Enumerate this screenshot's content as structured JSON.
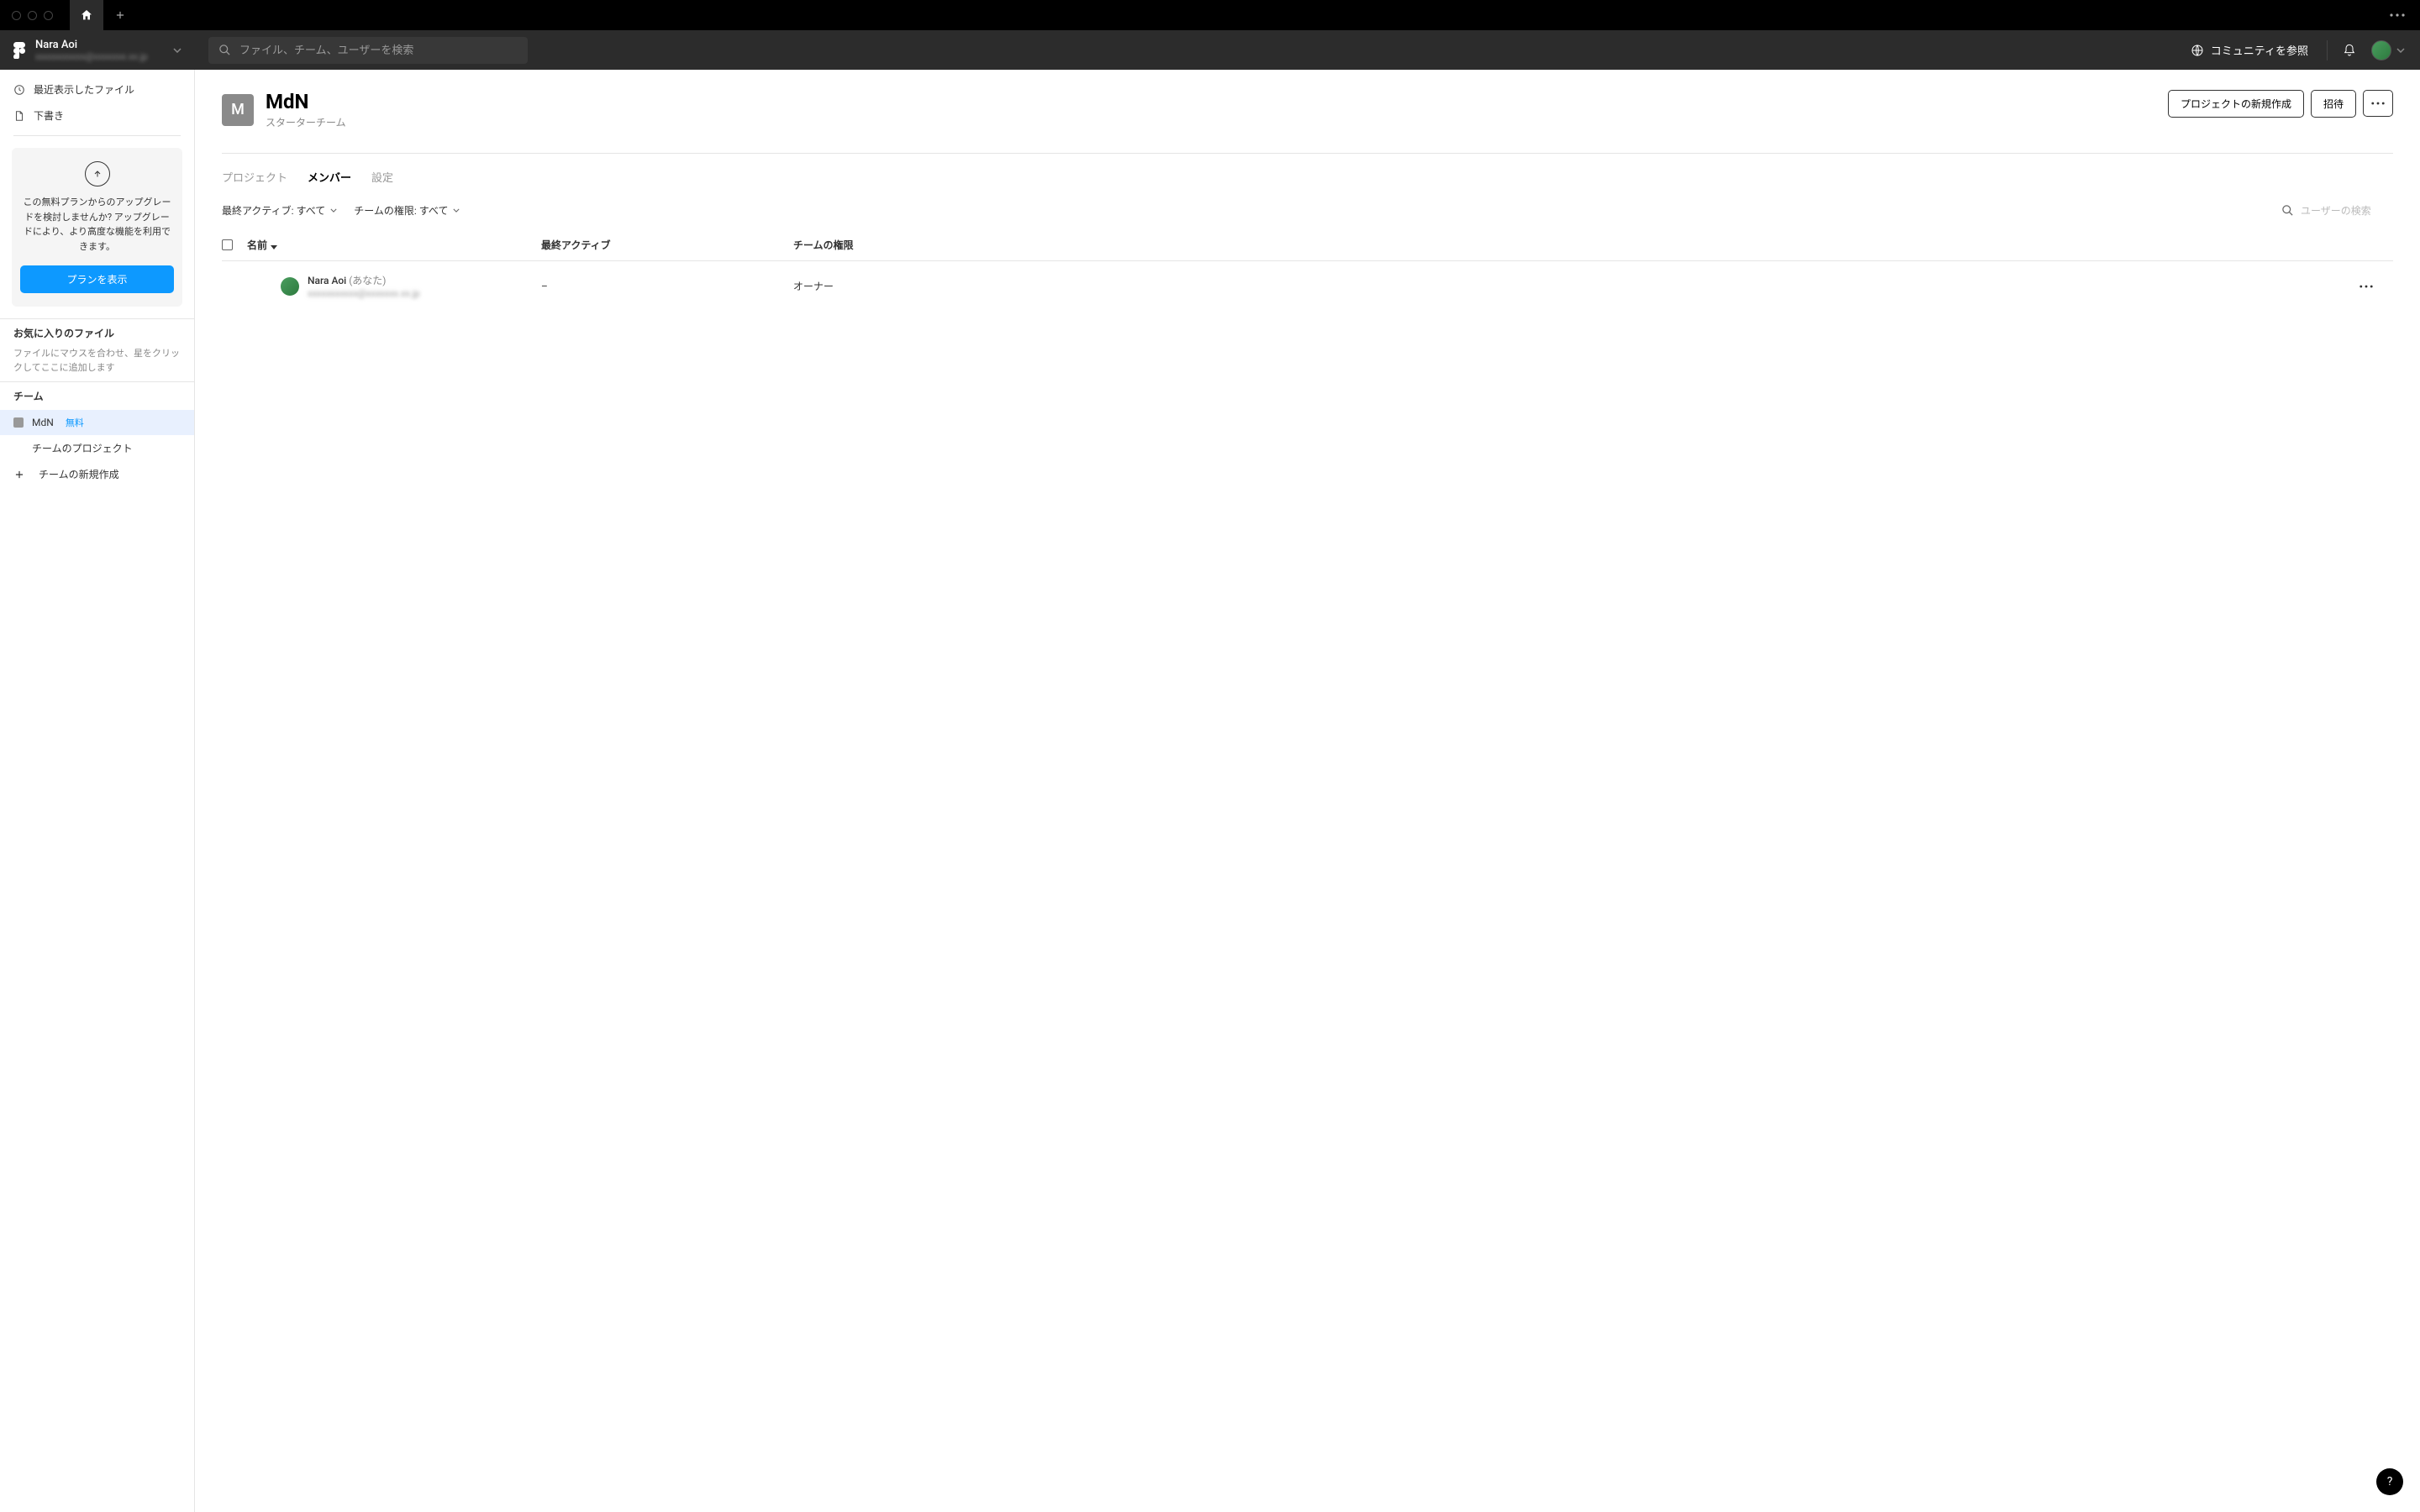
{
  "user": {
    "name": "Nara Aoi",
    "email": "xxxxxxxxxxx@xxxxxxx.xx.jp"
  },
  "search": {
    "placeholder": "ファイル、チーム、ユーザーを検索"
  },
  "topbar": {
    "community": "コミュニティを参照"
  },
  "sidebar": {
    "recent": "最近表示したファイル",
    "drafts": "下書き",
    "upgrade_text": "この無料プランからのアップグレードを検討しませんか? アップグレードにより、より高度な機能を利用できます。",
    "upgrade_btn": "プランを表示",
    "fav_label": "お気に入りのファイル",
    "fav_desc": "ファイルにマウスを合わせ、星をクリックしてここに追加します",
    "team_label": "チーム",
    "teams": [
      {
        "name": "MdN",
        "badge": "無料"
      }
    ],
    "team_projects": "チームのプロジェクト",
    "create_team": "チームの新規作成"
  },
  "team": {
    "initial": "M",
    "name": "MdN",
    "subtitle": "スターターチーム",
    "actions": {
      "new_project": "プロジェクトの新規作成",
      "invite": "招待"
    }
  },
  "tabs": {
    "projects": "プロジェクト",
    "members": "メンバー",
    "settings": "設定"
  },
  "filters": {
    "last_active": "最終アクティブ: すべて",
    "permissions": "チームの権限: すべて",
    "user_search_placeholder": "ユーザーの検索"
  },
  "table": {
    "headers": {
      "name": "名前",
      "last_active": "最終アクティブ",
      "permissions": "チームの権限"
    },
    "rows": [
      {
        "name": "Nara Aoi",
        "you": "(あなた)",
        "email": "xxxxxxxxxxx@xxxxxxx.xx.jp",
        "last_active": "–",
        "permission": "オーナー"
      }
    ]
  },
  "help": "?"
}
